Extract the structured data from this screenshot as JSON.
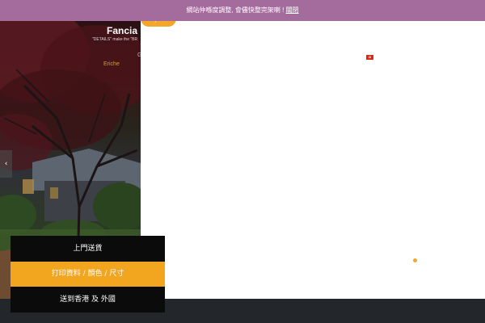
{
  "banner": {
    "message": "網站仲喺度調整, 會儘快整完架喇 ! ",
    "dismiss_label": "關閉",
    "color": "#a46b9d"
  },
  "hero": {
    "title": "Fancia",
    "subtitle": "\"DETAILS\" make the \"BR",
    "glyph": "G",
    "link_label": "Eriche"
  },
  "buy_pill": {
    "label": "Buy Now",
    "color": "#f4a62a"
  },
  "carousel": {
    "prev_icon": "chevron-left-icon",
    "prev_glyph": "‹"
  },
  "flag": {
    "icon": "hong-kong-flag-icon",
    "glyph": "✿"
  },
  "side_menu": {
    "items": [
      {
        "label": "上門送貨"
      },
      {
        "label": "打印資料 / 顏色 / 尺寸"
      },
      {
        "label": "送到香港 及 外國"
      }
    ],
    "active_color": "#f2a51f"
  },
  "colors": {
    "footer": "#23262b",
    "accent": "#f0a92a"
  }
}
